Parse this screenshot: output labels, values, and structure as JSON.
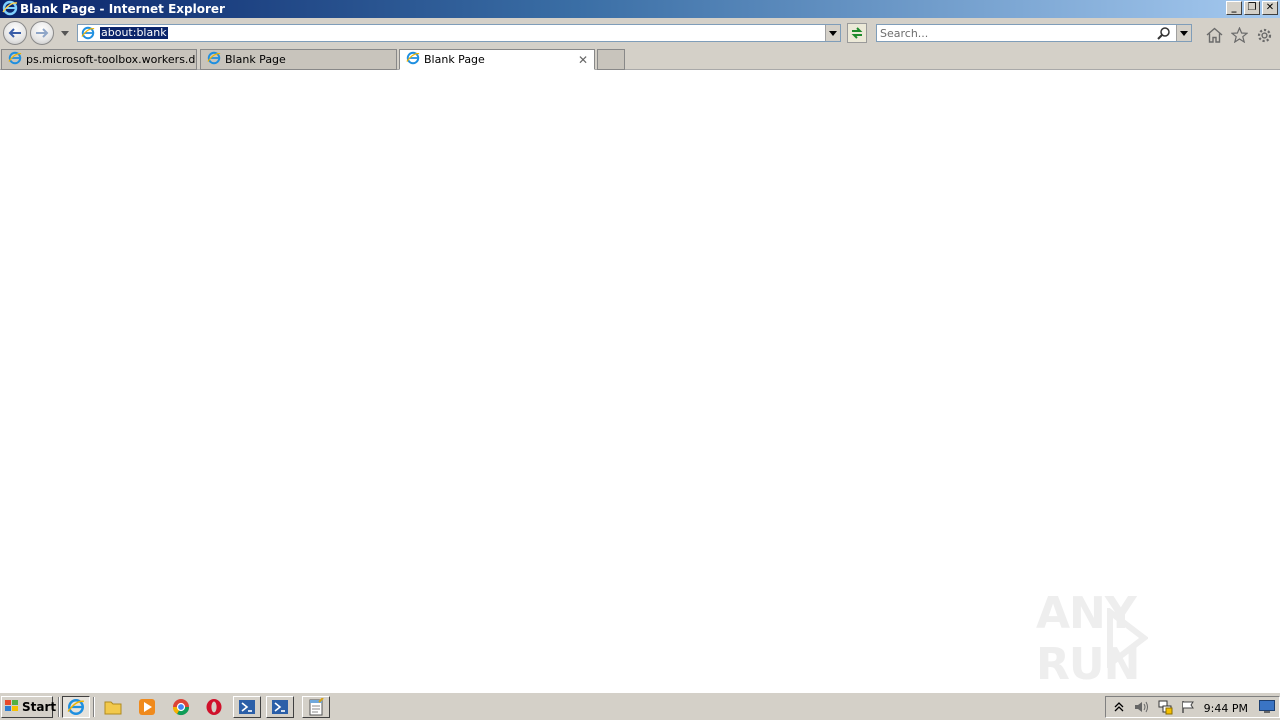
{
  "window": {
    "title": "Blank Page - Internet Explorer",
    "minimize": "_",
    "restore": "❐",
    "close": "✕"
  },
  "address_bar": {
    "url": "about:blank"
  },
  "search": {
    "placeholder": "Search..."
  },
  "tabs": [
    {
      "label": "ps.microsoft-toolbox.workers.dev",
      "active": false
    },
    {
      "label": "Blank Page",
      "active": false
    },
    {
      "label": "Blank Page",
      "active": true
    }
  ],
  "watermark": {
    "text": "ANY RUN"
  },
  "taskbar": {
    "start_label": "Start",
    "clock": "9:44 PM"
  },
  "colors": {
    "title_gradient_start": "#0a246a",
    "title_gradient_end": "#a6caf0",
    "chrome": "#d4d0c8",
    "selection": "#0a246a"
  }
}
